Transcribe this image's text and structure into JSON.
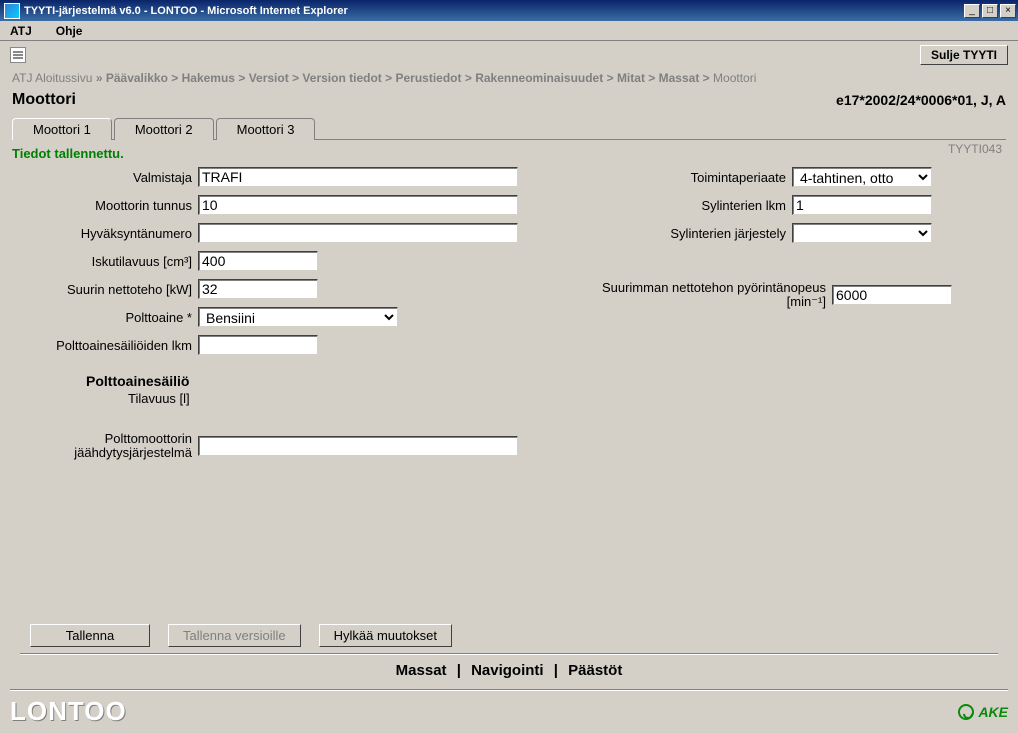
{
  "window": {
    "title": "TYYTI-järjestelmä v6.0 - LONTOO - Microsoft Internet Explorer",
    "min_glyph": "_",
    "max_glyph": "□",
    "close_glyph": "×"
  },
  "menubar": {
    "atj": "ATJ",
    "ohje": "Ohje"
  },
  "buttons": {
    "close_tyyti": "Sulje TYYTI",
    "save": "Tallenna",
    "save_versions": "Tallenna versioille",
    "discard": "Hylkää muutokset"
  },
  "breadcrumb": {
    "items": [
      {
        "label": "ATJ Aloitussivu",
        "bold": false
      },
      {
        "label": "Päävalikko",
        "bold": true
      },
      {
        "label": "Hakemus",
        "bold": true
      },
      {
        "label": "Versiot",
        "bold": true
      },
      {
        "label": "Version tiedot",
        "bold": true
      },
      {
        "label": "Perustiedot",
        "bold": true
      },
      {
        "label": "Rakenneominaisuudet",
        "bold": true
      },
      {
        "label": "Mitat",
        "bold": true
      },
      {
        "label": "Massat",
        "bold": true
      },
      {
        "label": "Moottori",
        "bold": false
      }
    ],
    "sep_after_first": "»",
    "sep": ">"
  },
  "page": {
    "title": "Moottori",
    "approval_code": "e17*2002/24*0006*01, J, A",
    "panel_code": "TYYTI043",
    "saved_msg": "Tiedot tallennettu."
  },
  "tabs": {
    "t1": "Moottori 1",
    "t2": "Moottori 2",
    "t3": "Moottori 3"
  },
  "labels": {
    "valmistaja": "Valmistaja",
    "moottorin_tunnus": "Moottorin tunnus",
    "hyvaksyntanumero": "Hyväksyntänumero",
    "iskutilavuus": "Iskutilavuus [cm³]",
    "suurin_nettoteho": "Suurin nettoteho [kW]",
    "polttoaine": "Polttoaine *",
    "sailioiden_lkm": "Polttoainesäiliöiden lkm",
    "sailio_header": "Polttoainesäiliö",
    "tilavuus": "Tilavuus [l]",
    "jaahdytys_l1": "Polttomoottorin",
    "jaahdytys_l2": "jäähdytysjärjestelmä",
    "toimintaperiaate": "Toimintaperiaate",
    "syl_lkm": "Sylinterien lkm",
    "syl_jarjestely": "Sylinterien järjestely",
    "rpm_l1": "Suurimman nettotehon pyörintänopeus",
    "rpm_l2": "[min⁻¹]"
  },
  "values": {
    "valmistaja": "TRAFI",
    "moottorin_tunnus": "10",
    "hyvaksyntanumero": "",
    "iskutilavuus": "400",
    "suurin_nettoteho": "32",
    "polttoaine": "Bensiini",
    "sailioiden_lkm": "",
    "jaahdytys": "",
    "toimintaperiaate": "4-tahtinen, otto",
    "syl_lkm": "1",
    "syl_jarjestely": "",
    "rpm": "6000"
  },
  "nav": {
    "prev": "Massat",
    "nav": "Navigointi",
    "next": "Päästöt"
  },
  "footer": {
    "env": "LONTOO",
    "ake": "AKE"
  }
}
